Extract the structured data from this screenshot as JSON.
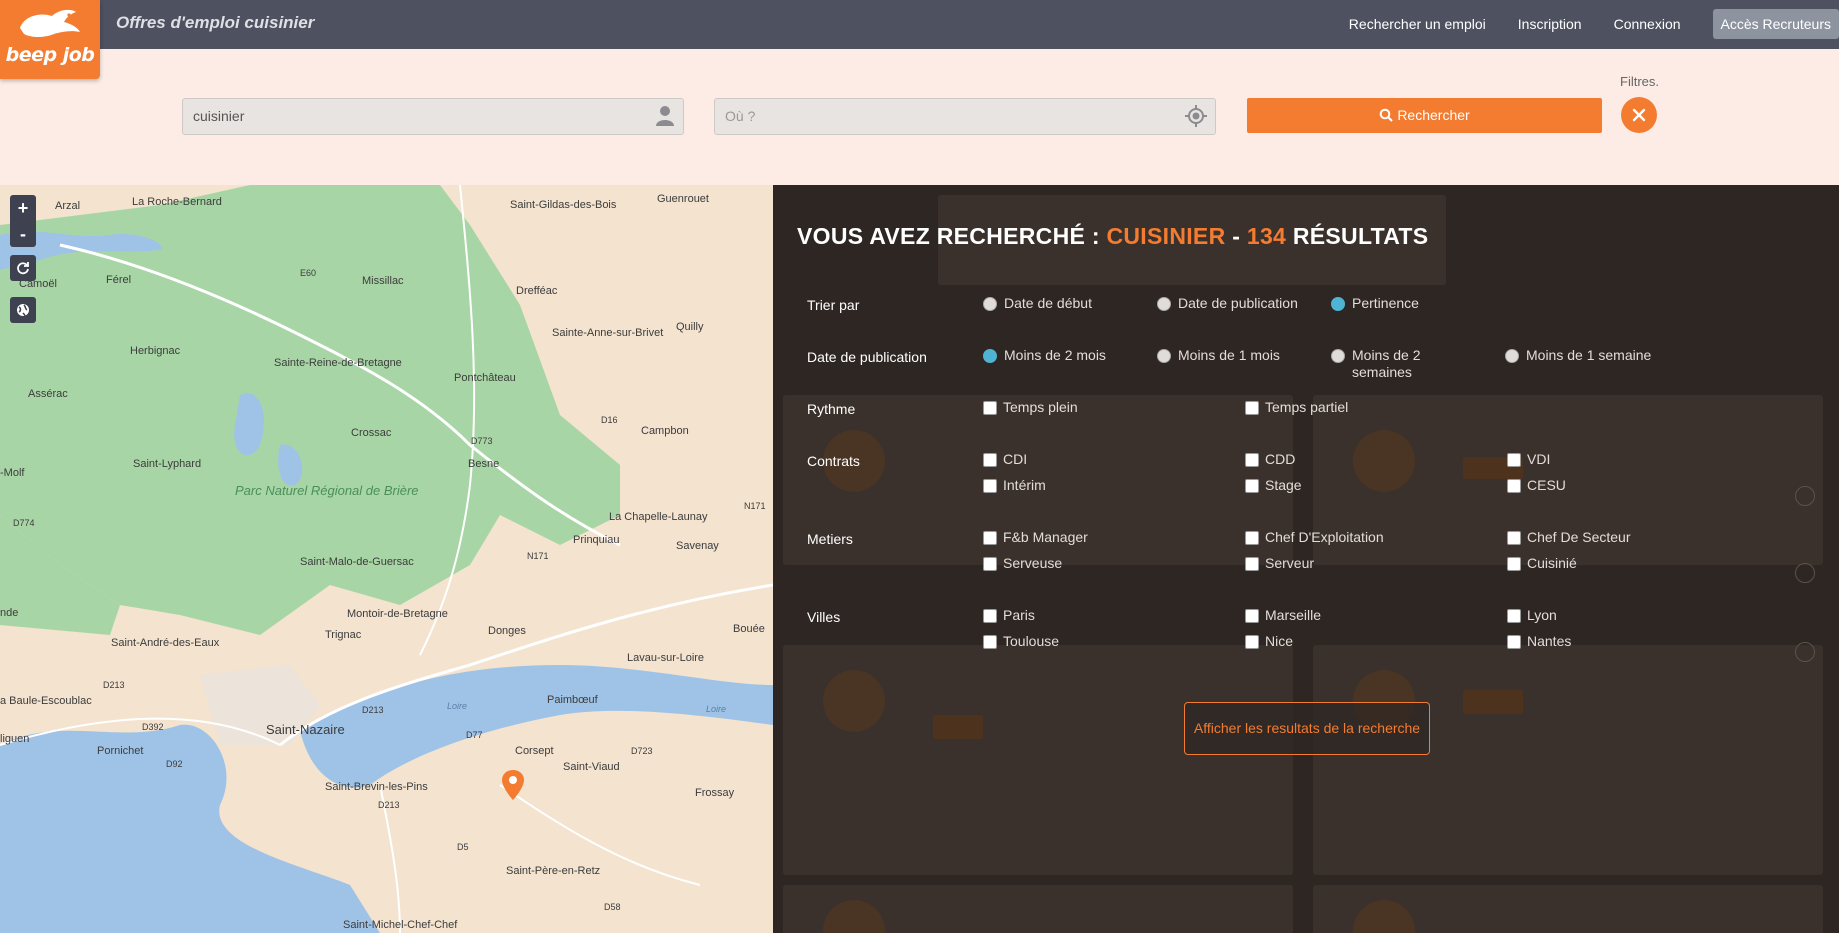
{
  "header": {
    "logo_text": "beep job",
    "title": "Offres d'emploi cuisinier",
    "nav": {
      "search_job": "Rechercher un emploi",
      "signup": "Inscription",
      "login": "Connexion",
      "recruiters": "Accès Recruteurs"
    }
  },
  "search": {
    "what_value": "cuisinier",
    "where_placeholder": "Où ?",
    "button_label": "Rechercher",
    "filters_label": "Filtres."
  },
  "map": {
    "park_label": "Parc Naturel Régional de Brière",
    "places": [
      "Arzal",
      "La Roche-Bernard",
      "Saint-Gildas-des-Bois",
      "Guenrouet",
      "Férel",
      "Missillac",
      "Drefféac",
      "Quilly",
      "Camoël",
      "Herbignac",
      "Sainte-Anne-sur-Brivet",
      "Sainte-Reine-de-Bretagne",
      "Pontchâteau",
      "Assérac",
      "Crossac",
      "Campbon",
      "Saint-Lyphard",
      "Besne",
      "-Molf",
      "La Chapelle-Launay",
      "Prinquiau",
      "Savenay",
      "Saint-Malo-de-Guersac",
      "Montoir-de-Bretagne",
      "Donges",
      "Bouée",
      "nde",
      "Saint-André-des-Eaux",
      "Trignac",
      "Lavau-sur-Loire",
      "a Baule-Escoublac",
      "Paimbœuf",
      "Saint-Nazaire",
      "Corsept",
      "liguen",
      "Pornichet",
      "Saint-Viaud",
      "Frossay",
      "Saint-Brevin-les-Pins",
      "Saint-Père-en-Retz",
      "Saint-Michel-Chef-Chef"
    ],
    "roads": [
      "E60",
      "D16",
      "D773",
      "N171",
      "D774",
      "N171",
      "D213",
      "D213",
      "D392",
      "D92",
      "D77",
      "D723",
      "D213",
      "D5",
      "D58"
    ],
    "river": "Loire",
    "river2": "Loire",
    "controls": {
      "zoom_in": "+",
      "zoom_out": "-"
    }
  },
  "results": {
    "title_prefix": "VOUS AVEZ RECHERCHÉ :",
    "query": "CUISINIER",
    "sep": "-",
    "count": "134",
    "title_suffix": "RÉSULTATS",
    "sort": {
      "label": "Trier par",
      "options": [
        "Date de début",
        "Date de publication",
        "Pertinence"
      ],
      "selected": "Pertinence"
    },
    "date": {
      "label": "Date de publication",
      "options": [
        "Moins de 2 mois",
        "Moins de 1 mois",
        "Moins de 2 semaines",
        "Moins de 1 semaine"
      ],
      "selected": "Moins de 2 mois"
    },
    "rythme": {
      "label": "Rythme",
      "options": [
        "Temps plein",
        "Temps partiel"
      ]
    },
    "contrats": {
      "label": "Contrats",
      "options": [
        "CDI",
        "CDD",
        "VDI",
        "Intérim",
        "Stage",
        "CESU"
      ]
    },
    "metiers": {
      "label": "Metiers",
      "options": [
        "F&b Manager",
        "Chef D'Exploitation",
        "Chef De Secteur",
        "Serveuse",
        "Serveur",
        "Cuisinié"
      ]
    },
    "villes": {
      "label": "Villes",
      "options": [
        "Paris",
        "Marseille",
        "Lyon",
        "Toulouse",
        "Nice",
        "Nantes"
      ]
    },
    "show_button": "Afficher les resultats de la recherche"
  },
  "colors": {
    "accent": "#f47c30",
    "radio_selected": "#4fb4d3",
    "topbar": "#4d5160",
    "overlay": "#2d2623"
  }
}
